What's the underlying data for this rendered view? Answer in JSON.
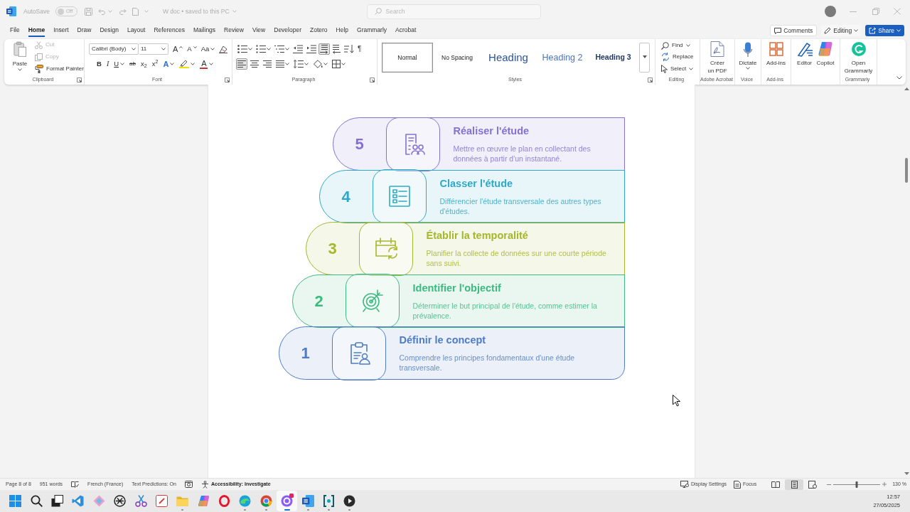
{
  "title_bar": {
    "autosave": {
      "label": "AutoSave",
      "toggle": "Off",
      "on": false
    },
    "document_title": "W doc • saved to this PC",
    "search": {
      "placeholder": "Search"
    }
  },
  "ribbon_tabs": [
    {
      "label": "File",
      "selected": false
    },
    {
      "label": "Home",
      "selected": true
    },
    {
      "label": "Insert",
      "selected": false
    },
    {
      "label": "Draw",
      "selected": false
    },
    {
      "label": "Design",
      "selected": false
    },
    {
      "label": "Layout",
      "selected": false
    },
    {
      "label": "References",
      "selected": false
    },
    {
      "label": "Mailings",
      "selected": false
    },
    {
      "label": "Review",
      "selected": false
    },
    {
      "label": "View",
      "selected": false
    },
    {
      "label": "Developer",
      "selected": false
    },
    {
      "label": "Zotero",
      "selected": false
    },
    {
      "label": "Help",
      "selected": false
    },
    {
      "label": "Grammarly",
      "selected": false
    },
    {
      "label": "Acrobat",
      "selected": false
    }
  ],
  "header_buttons": [
    {
      "kind": "comments",
      "label": "Comments"
    },
    {
      "kind": "editing",
      "label": "Editing"
    },
    {
      "kind": "share",
      "label": "Share"
    }
  ],
  "ribbon": {
    "clipboard": {
      "label": "Clipboard",
      "paste": "Paste",
      "items": [
        {
          "kind": "cut",
          "label": "Cut",
          "disabled": true
        },
        {
          "kind": "copy",
          "label": "Copy",
          "disabled": true
        },
        {
          "kind": "format_painter",
          "label": "Format Painter",
          "disabled": false
        }
      ]
    },
    "font": {
      "label": "Font",
      "font_name": "Calibri (Body)",
      "font_size": "11",
      "row_1": [
        {
          "kind": "grow",
          "glyph": "A",
          "dropdown": false
        },
        {
          "kind": "shrink",
          "glyph": "A",
          "dropdown": false
        },
        {
          "kind": "case",
          "glyph": "Aa",
          "dropdown": true
        },
        {
          "kind": "clear",
          "dropdown": false
        }
      ],
      "row_2": [
        {
          "kind": "bold",
          "glyph": "B",
          "dropdown": false
        },
        {
          "kind": "italic",
          "glyph": "I",
          "dropdown": false
        },
        {
          "kind": "underline",
          "glyph": "U",
          "dropdown": true
        },
        {
          "kind": "strikethrough",
          "glyph": "ab",
          "dropdown": false
        },
        {
          "kind": "subscript",
          "glyph": "x$_{2}$",
          "dropdown": false
        },
        {
          "kind": "superscript",
          "glyph": "x$^{2}$",
          "dropdown": false
        },
        {
          "kind": "effects",
          "glyph": "A",
          "dropdown": true
        },
        {
          "kind": "highlight",
          "dropdown": true
        },
        {
          "kind": "font_color",
          "glyph": "A",
          "dropdown": true
        }
      ]
    },
    "paragraph": {
      "label": "Paragraph",
      "row_1": [
        {
          "kind": "bullets",
          "dropdown": true,
          "selected": false
        },
        {
          "kind": "numbering",
          "dropdown": true,
          "selected": false
        },
        {
          "kind": "multilevel",
          "dropdown": true,
          "selected": false
        },
        {
          "kind": "decrease_indent",
          "dropdown": false,
          "selected": false
        },
        {
          "kind": "increase_indent",
          "dropdown": false,
          "selected": false
        },
        {
          "kind": "ltr",
          "dropdown": false,
          "selected": true
        },
        {
          "kind": "rtl",
          "dropdown": false,
          "selected": false
        },
        {
          "kind": "sort",
          "dropdown": false,
          "selected": false
        },
        {
          "kind": "marks",
          "glyph": "¶",
          "dropdown": false,
          "selected": false
        }
      ],
      "row_2": [
        {
          "kind": "align_left",
          "dropdown": false,
          "selected": true
        },
        {
          "kind": "align_center",
          "dropdown": false,
          "selected": false
        },
        {
          "kind": "align_right",
          "dropdown": false,
          "selected": false
        },
        {
          "kind": "justify",
          "dropdown": true,
          "selected": false
        },
        {
          "kind": "line_spacing",
          "dropdown": true,
          "selected": false
        },
        {
          "kind": "shading",
          "dropdown": true,
          "selected": false
        },
        {
          "kind": "borders",
          "dropdown": true,
          "selected": false
        }
      ]
    },
    "styles": {
      "label": "Styles",
      "items": [
        {
          "kind": "normal",
          "label": "Normal",
          "selected": true
        },
        {
          "kind": "no_spacing",
          "label": "No Spacing",
          "selected": false
        },
        {
          "kind": "heading1",
          "label": "Heading",
          "selected": false
        },
        {
          "kind": "heading2",
          "label": "Heading 2",
          "selected": false
        },
        {
          "kind": "heading3",
          "label": "Heading 3",
          "selected": false
        }
      ]
    },
    "editing": {
      "label": "Editing",
      "items": [
        {
          "kind": "find",
          "label": "Find",
          "dropdown": true
        },
        {
          "kind": "replace",
          "label": "Replace",
          "dropdown": false
        },
        {
          "kind": "select",
          "label": "Select",
          "dropdown": true
        }
      ]
    },
    "groups": [
      {
        "label": "Adobe Acrobat",
        "buttons": [
          {
            "kind": "pdf",
            "label": "Créer\nun PDF",
            "dropdown": false
          }
        ]
      },
      {
        "label": "Voice",
        "buttons": [
          {
            "kind": "dictate",
            "label": "Dictate",
            "dropdown": true
          }
        ]
      },
      {
        "label": "Add-ins",
        "buttons": [
          {
            "kind": "addins",
            "label": "Add-ins",
            "dropdown": false
          }
        ]
      },
      {
        "buttons": [
          {
            "kind": "editor",
            "label": "Editor",
            "dropdown": false
          },
          {
            "kind": "copilot",
            "label": "Copilot",
            "dropdown": false
          }
        ]
      },
      {
        "label": "Grammarly",
        "buttons": [
          {
            "kind": "grammarly",
            "label": "Open\nGrammarly",
            "dropdown": false
          }
        ]
      }
    ]
  },
  "steps": [
    {
      "number": "5",
      "kind": "document_people",
      "title": "Réaliser l'étude",
      "description": "Mettre en œuvre le plan en collectant des données à partir d'un instantané.",
      "color": "#8471d2"
    },
    {
      "number": "4",
      "kind": "checklist",
      "title": "Classer l'étude",
      "description": "Différencier l'étude transversale des autres types d'études.",
      "color": "#2ea9c7"
    },
    {
      "number": "3",
      "kind": "calendar_refresh",
      "title": "Établir la temporalité",
      "description": "Planifier la collecte de données sur une courte période sans suivi.",
      "color": "#a5b72c"
    },
    {
      "number": "2",
      "kind": "target_arrow",
      "title": "Identifier l'objectif",
      "description": "Déterminer le but principal de l'étude, comme estimer la prévalence.",
      "color": "#3cba80"
    },
    {
      "number": "1",
      "kind": "clipboard_person",
      "title": "Définir le concept",
      "description": "Comprendre les principes fondamentaux d'une étude transversale.",
      "color": "#4f7cc6"
    }
  ],
  "status_bar": {
    "left": [
      {
        "kind": "page",
        "label": "Page 8 of 8"
      },
      {
        "kind": "words",
        "label": "951 words"
      },
      {
        "kind": "proofing"
      },
      {
        "kind": "language",
        "label": "French (France)"
      },
      {
        "kind": "predictions",
        "label": "Text Predictions: On"
      },
      {
        "kind": "macro"
      },
      {
        "kind": "accessibility",
        "label": "Accessibility: Investigate"
      }
    ],
    "right": [
      {
        "kind": "display",
        "label": "Display Settings"
      },
      {
        "kind": "focus",
        "label": "Focus"
      }
    ],
    "views": [
      {
        "kind": "read",
        "selected": false
      },
      {
        "kind": "print",
        "selected": true
      },
      {
        "kind": "web",
        "selected": false
      }
    ],
    "zoom": {
      "level": 0.5,
      "reading": "130 %"
    }
  },
  "taskbar": {
    "apps": [
      {
        "kind": "start",
        "running": false,
        "selected": false,
        "badge": false
      },
      {
        "kind": "search",
        "running": false,
        "selected": false,
        "badge": false
      },
      {
        "kind": "taskview",
        "running": false,
        "selected": false,
        "badge": false
      },
      {
        "kind": "code",
        "running": false,
        "selected": false,
        "badge": false
      },
      {
        "kind": "diamond",
        "running": false,
        "selected": false,
        "badge": false
      },
      {
        "kind": "knot",
        "running": false,
        "selected": false,
        "badge": false
      },
      {
        "kind": "snip",
        "running": false,
        "selected": false,
        "badge": false
      },
      {
        "kind": "tile",
        "running": false,
        "selected": false,
        "badge": false
      },
      {
        "kind": "folder",
        "running": true,
        "selected": false,
        "badge": false
      },
      {
        "kind": "colorful",
        "running": false,
        "selected": false,
        "badge": false
      },
      {
        "kind": "ring",
        "running": false,
        "selected": false,
        "badge": false
      },
      {
        "kind": "wave",
        "running": true,
        "selected": false,
        "badge": false
      },
      {
        "kind": "chrome",
        "running": true,
        "selected": false,
        "badge": false
      },
      {
        "kind": "purple",
        "running": true,
        "selected": true,
        "badge": true
      },
      {
        "kind": "word",
        "running": true,
        "selected": false,
        "badge": false
      },
      {
        "kind": "bracket",
        "running": true,
        "selected": false,
        "badge": false
      },
      {
        "kind": "play",
        "running": true,
        "selected": false,
        "badge": false
      }
    ],
    "clock": {
      "time": "12:57",
      "date": "27/05/2025"
    }
  }
}
